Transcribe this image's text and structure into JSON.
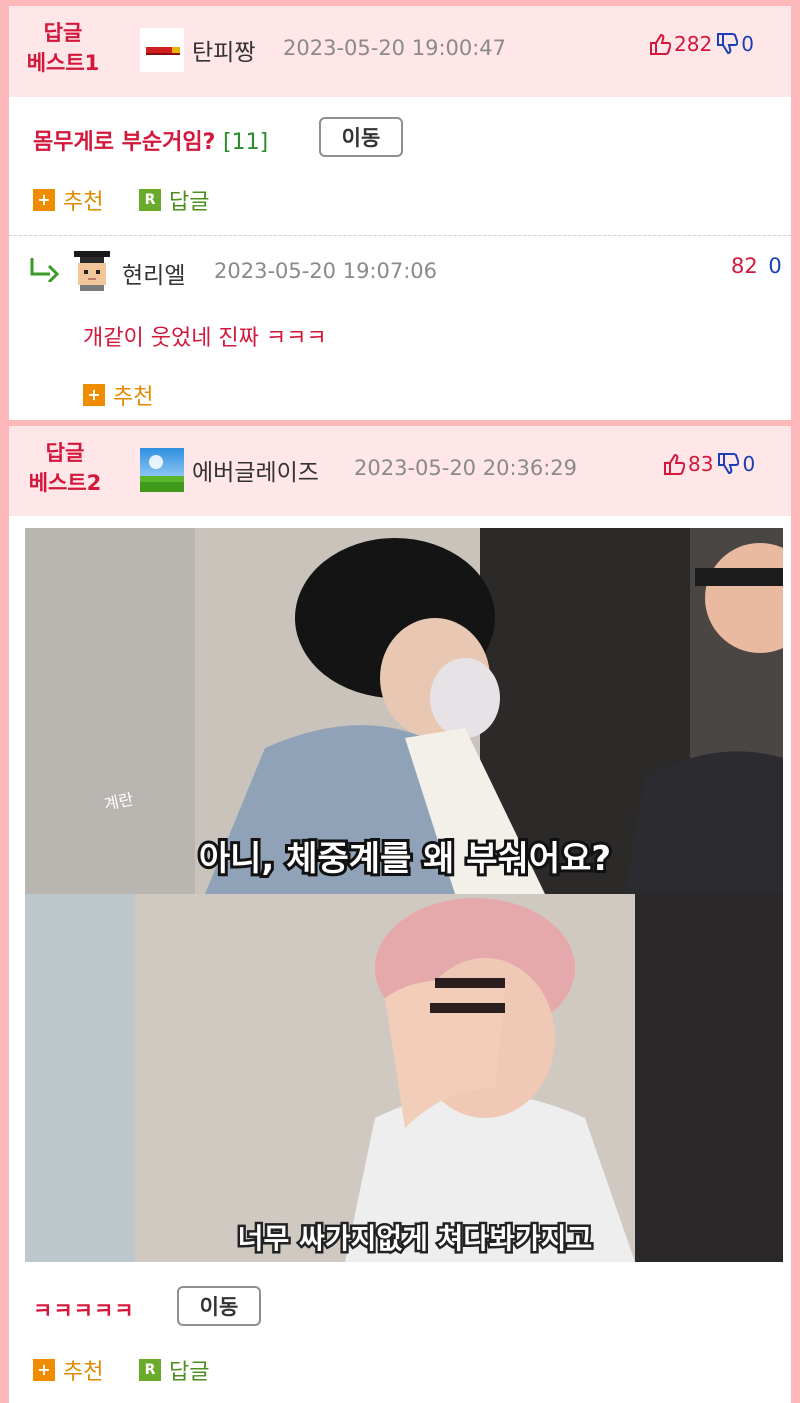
{
  "best1": {
    "badge_line1": "답글",
    "badge_line2": "베스트1",
    "nickname": "탄피짱",
    "date": "2023-05-20 19:00:47",
    "upvotes": "282",
    "downvotes": "0",
    "title": "몸무게로 부순거임?",
    "comment_count": "[11]",
    "move_label": "이동",
    "recommend_label": "추천",
    "reply_label": "답글"
  },
  "reply1": {
    "nickname": "현리엘",
    "date": "2023-05-20 19:07:06",
    "upvotes": "82",
    "downvotes": "0",
    "text": "개같이 웃었네 진짜 ㅋㅋㅋ",
    "recommend_label": "추천"
  },
  "best2": {
    "badge_line1": "답글",
    "badge_line2": "베스트2",
    "nickname": "에버글레이즈",
    "date": "2023-05-20 20:36:29",
    "upvotes": "83",
    "downvotes": "0",
    "image": {
      "top_tag": "계란",
      "top_caption": "아니, 체중계를 왜 부숴어요?",
      "bottom_caption": "너무 싸가지없게 쳐다봐가지고"
    },
    "text": "ㅋㅋㅋㅋㅋ",
    "move_label": "이동",
    "recommend_label": "추천",
    "reply_label": "답글"
  },
  "icons": {
    "plus_glyph": "+",
    "reply_glyph": "R"
  },
  "colors": {
    "accent_red": "#d4173a",
    "vote_blue": "#1a3fb5",
    "header_pink": "#ffe6e8",
    "frame_pink": "#ffb8ba",
    "recommend_orange": "#e08a00",
    "reply_green": "#4d8f1e"
  }
}
